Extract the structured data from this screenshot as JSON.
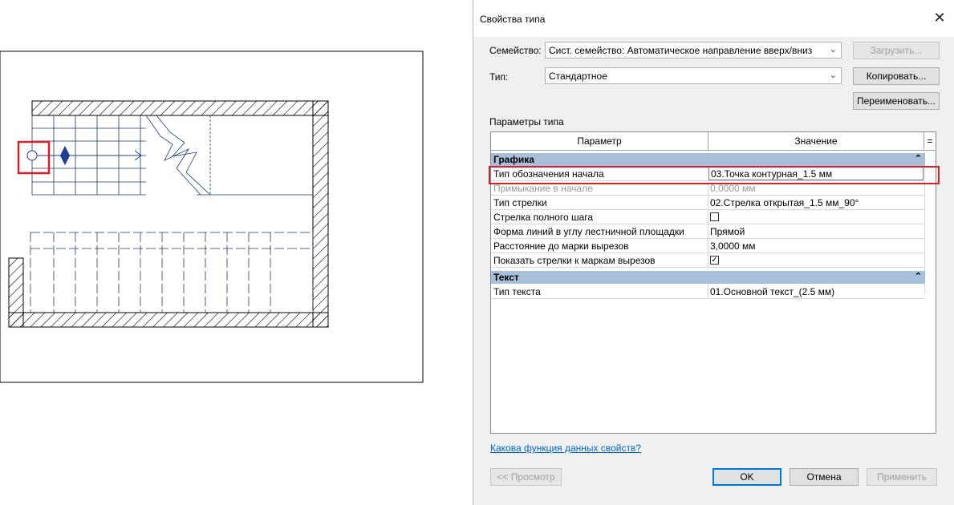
{
  "dialog": {
    "title": "Свойства типа",
    "family_label": "Семейство:",
    "family_value": "Сист. семейство: Автоматическое направление вверх/вниз",
    "type_label": "Тип:",
    "type_value": "Стандартное",
    "load_button": "Загрузить...",
    "copy_button": "Копировать...",
    "rename_button": "Переименовать...",
    "type_params_label": "Параметры типа",
    "grid": {
      "col_param": "Параметр",
      "col_value": "Значение",
      "col_toggle": "=",
      "groups": [
        {
          "name": "Графика",
          "rows": [
            {
              "name": "Тип обозначения начала",
              "value": "03.Точка контурная_1.5 мм"
            },
            {
              "name": "Примыкание в начале",
              "value": "0,0000 мм"
            },
            {
              "name": "Тип стрелки",
              "value": "02.Стрелка открытая_1.5 мм_90°"
            },
            {
              "name": "Стрелка полного шага",
              "value": ""
            },
            {
              "name": "Форма линий в углу лестничной площадки",
              "value": "Прямой"
            },
            {
              "name": "Расстояние до марки вырезов",
              "value": "3,0000 мм"
            },
            {
              "name": "Показать стрелки к маркам вырезов",
              "value": ""
            }
          ]
        },
        {
          "name": "Текст",
          "rows": [
            {
              "name": "Тип текста",
              "value": "01.Основной текст_(2.5 мм)"
            }
          ]
        }
      ]
    },
    "help_link": "Какова функция данных свойств?",
    "preview_button": "<< Просмотр",
    "ok_button": "OK",
    "cancel_button": "Отмена",
    "apply_button": "Применить"
  },
  "colors": {
    "highlight": "#d6212b",
    "group_header": "#a8bfd9",
    "arrow": "#1f3d99",
    "link": "#0066cc"
  },
  "icons": {
    "close": "close-icon",
    "combo_arrow": "chevron-down-icon",
    "collapse": "collapse-up-icon",
    "checkbox_checked": "checkmark-icon"
  }
}
